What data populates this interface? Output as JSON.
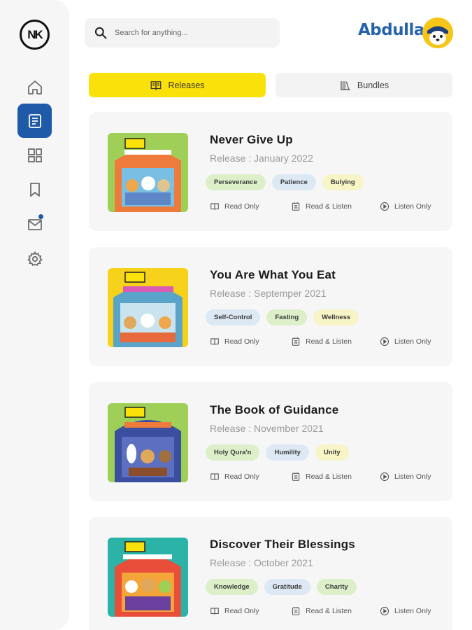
{
  "brand": {
    "logo_text": "NK"
  },
  "sidebar": {
    "items": [
      {
        "name": "home",
        "active": false
      },
      {
        "name": "releases",
        "active": true
      },
      {
        "name": "dashboard",
        "active": false
      },
      {
        "name": "bookmarks",
        "active": false
      },
      {
        "name": "mail",
        "active": false,
        "badge": true
      },
      {
        "name": "settings",
        "active": false
      }
    ]
  },
  "search": {
    "placeholder": "Search for anything..."
  },
  "user": {
    "name": "Abdullah"
  },
  "tabs": [
    {
      "label": "Releases",
      "active": true
    },
    {
      "label": "Bundles",
      "active": false
    }
  ],
  "actions": {
    "read_only": "Read Only",
    "read_listen": "Read & Listen",
    "listen_only": "Listen Only"
  },
  "books": [
    {
      "title": "Never Give Up",
      "release": "Release : January 2022",
      "tags": [
        {
          "label": "Perseverance",
          "color": "green"
        },
        {
          "label": "Patience",
          "color": "blue"
        },
        {
          "label": "Bulying",
          "color": "yellow"
        }
      ]
    },
    {
      "title": "You Are What You Eat",
      "release": "Release : Septemper 2021",
      "tags": [
        {
          "label": "Self-Control",
          "color": "blue"
        },
        {
          "label": "Fasting",
          "color": "green"
        },
        {
          "label": "Wellness",
          "color": "yellow"
        }
      ]
    },
    {
      "title": "The Book of Guidance",
      "release": "Release : November 2021",
      "tags": [
        {
          "label": "Holy Qura'n",
          "color": "green"
        },
        {
          "label": "Humility",
          "color": "blue"
        },
        {
          "label": "Unity",
          "color": "yellow"
        }
      ]
    },
    {
      "title": "Discover Their Blessings",
      "release": "Release : October 2021",
      "tags": [
        {
          "label": "Knowledge",
          "color": "green"
        },
        {
          "label": "Gratitude",
          "color": "blue"
        },
        {
          "label": "Charity",
          "color": "green"
        }
      ]
    }
  ],
  "colors": {
    "accent": "#1e5aa8",
    "active_tab": "#fbe10a",
    "brand_blue": "#2563ad"
  }
}
